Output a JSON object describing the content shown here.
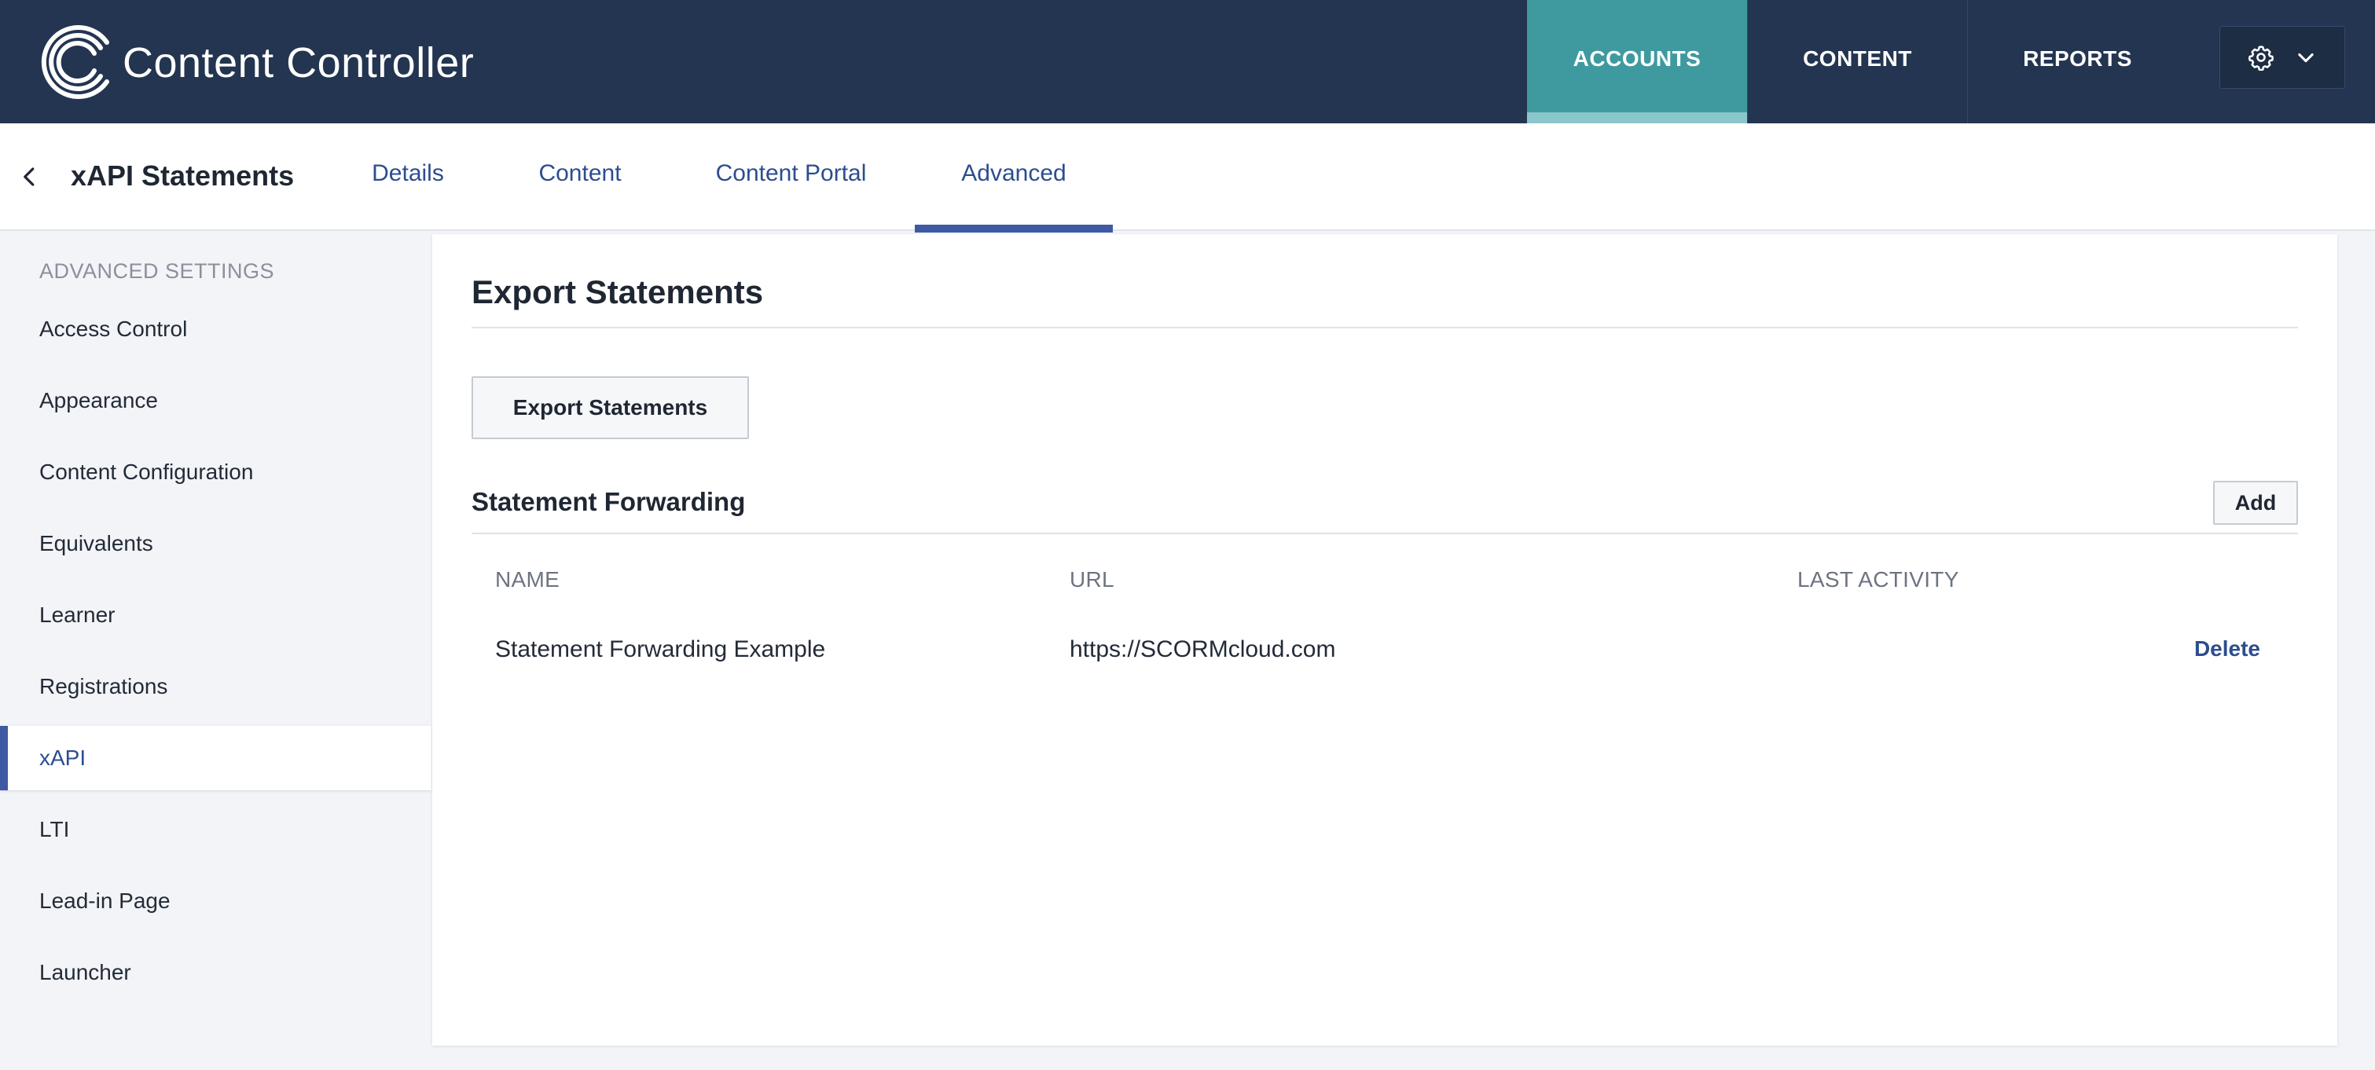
{
  "app": {
    "brand": "Content Controller"
  },
  "topnav": {
    "tabs": [
      {
        "label": "ACCOUNTS",
        "active": true
      },
      {
        "label": "CONTENT",
        "active": false
      },
      {
        "label": "REPORTS",
        "active": false
      }
    ],
    "settings_icon": "gear-icon",
    "dropdown_icon": "chevron-down-icon"
  },
  "subheader": {
    "back_icon": "chevron-left-icon",
    "title": "xAPI Statements",
    "tabs": [
      {
        "label": "Details",
        "active": false
      },
      {
        "label": "Content",
        "active": false
      },
      {
        "label": "Content Portal",
        "active": false
      },
      {
        "label": "Advanced",
        "active": true
      }
    ]
  },
  "sidebar": {
    "heading": "ADVANCED SETTINGS",
    "items": [
      {
        "label": "Access Control",
        "active": false
      },
      {
        "label": "Appearance",
        "active": false
      },
      {
        "label": "Content Configuration",
        "active": false
      },
      {
        "label": "Equivalents",
        "active": false
      },
      {
        "label": "Learner",
        "active": false
      },
      {
        "label": "Registrations",
        "active": false
      },
      {
        "label": "xAPI",
        "active": true
      },
      {
        "label": "LTI",
        "active": false
      },
      {
        "label": "Lead-in Page",
        "active": false
      },
      {
        "label": "Launcher",
        "active": false
      }
    ]
  },
  "main": {
    "title": "Export Statements",
    "export_button": "Export Statements",
    "forwarding": {
      "title": "Statement Forwarding",
      "add_button": "Add",
      "columns": [
        "NAME",
        "URL",
        "LAST ACTIVITY"
      ],
      "rows": [
        {
          "name": "Statement Forwarding Example",
          "url": "https://SCORMcloud.com",
          "last_activity": "",
          "action": "Delete"
        }
      ]
    }
  },
  "colors": {
    "topbar": "#233550",
    "active_tab": "#3f9aa0",
    "accent": "#3e5aa3",
    "link": "#2c4d8f"
  }
}
